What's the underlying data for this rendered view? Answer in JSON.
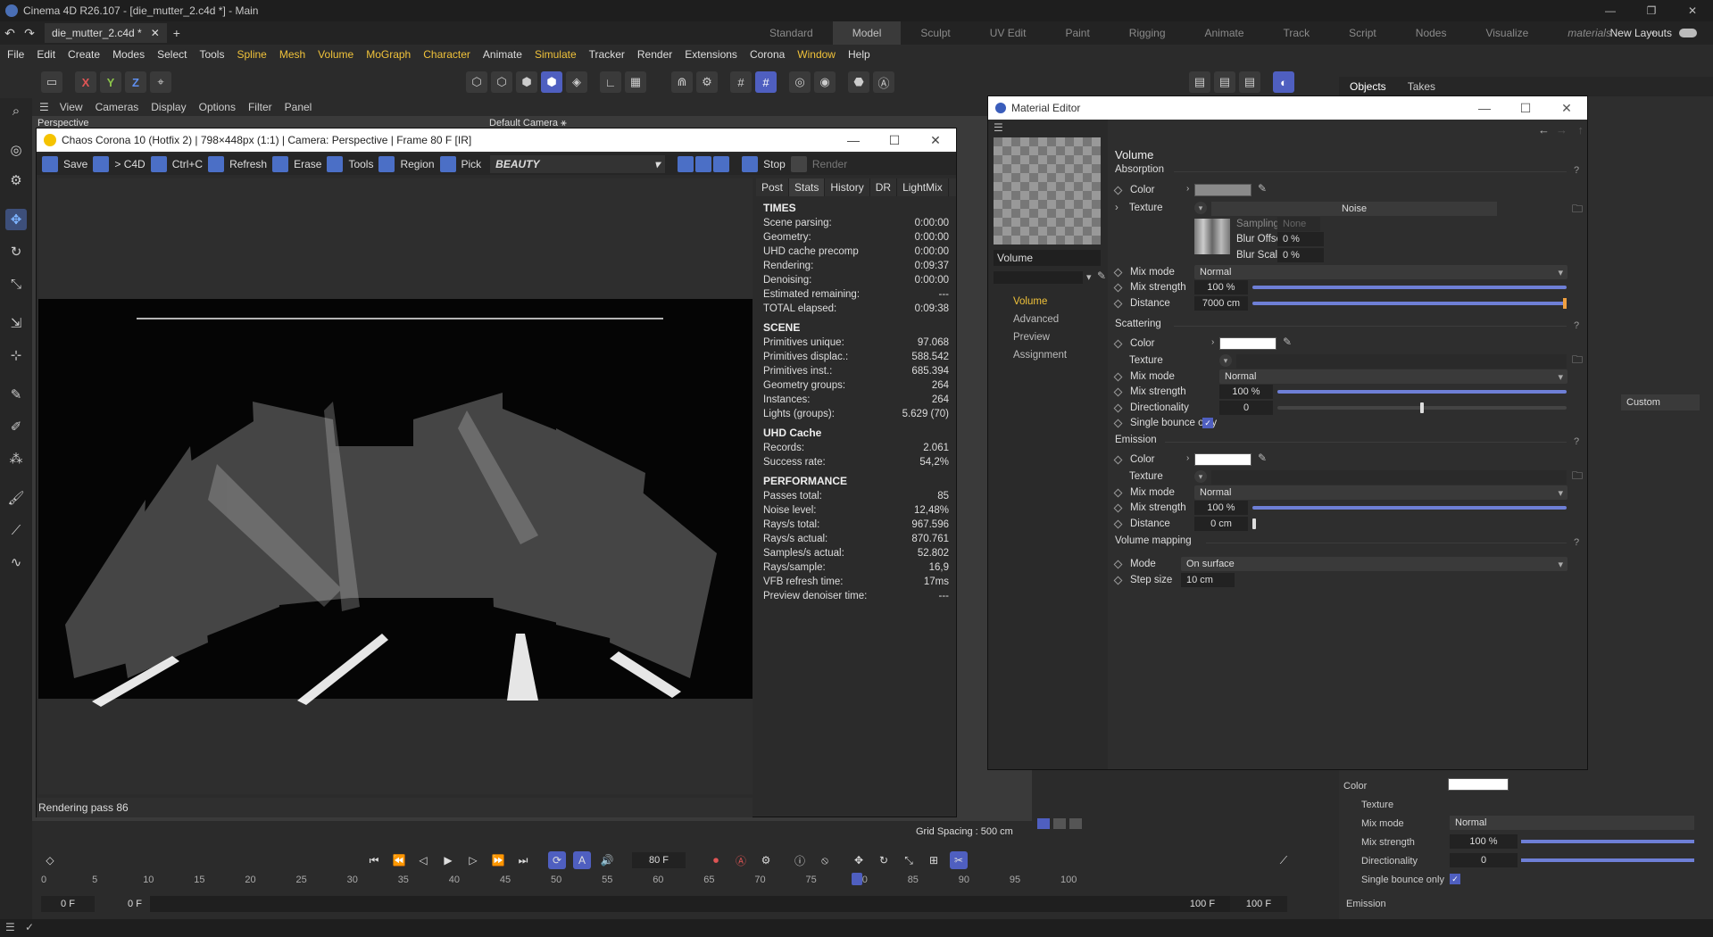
{
  "window": {
    "title": "Cinema 4D R26.107 - [die_mutter_2.c4d *] - Main",
    "min": "—",
    "max": "❐",
    "close": "✕"
  },
  "doc_tab": {
    "label": "die_mutter_2.c4d *",
    "close": "✕",
    "add": "+"
  },
  "layouts": [
    "Standard",
    "Model",
    "Sculpt",
    "UV Edit",
    "Paint",
    "Rigging",
    "Animate",
    "Track",
    "Script",
    "Nodes",
    "Visualize",
    "materials"
  ],
  "new_layouts": "New Layouts",
  "menu": [
    "File",
    "Edit",
    "Create",
    "Modes",
    "Select",
    "Tools",
    "Spline",
    "Mesh",
    "Volume",
    "MoGraph",
    "Character",
    "Animate",
    "Simulate",
    "Tracker",
    "Render",
    "Extensions",
    "Corona",
    "Window",
    "Help"
  ],
  "axes": {
    "x": "X",
    "y": "Y",
    "z": "Z"
  },
  "view_menu": [
    "View",
    "Cameras",
    "Display",
    "Options",
    "Filter",
    "Panel"
  ],
  "viewport": {
    "label": "Perspective",
    "camera": "Default Camera ⚹",
    "grid_spacing": "Grid Spacing : 500 cm"
  },
  "right_panel": {
    "tabs": [
      "Objects",
      "Takes"
    ],
    "custom": "Custom",
    "color_label": "Color",
    "texture_label": "Texture",
    "mixmode_label": "Mix mode",
    "mixmode_value": "Normal",
    "mixstrength_label": "Mix strength",
    "mixstrength_value": "100 %",
    "directionality_label": "Directionality",
    "directionality_value": "0",
    "single_bounce_label": "Single bounce only",
    "emission_label": "Emission",
    "qm": "?"
  },
  "corona": {
    "title": "Chaos Corona 10 (Hotfix 2) | 798×448px (1:1) | Camera: Perspective | Frame 80 F [IR]",
    "buttons": {
      "save": "Save",
      "c4d": "> C4D",
      "ctrlc": "Ctrl+C",
      "refresh": "Refresh",
      "erase": "Erase",
      "tools": "Tools",
      "region": "Region",
      "pick": "Pick",
      "stop": "Stop",
      "render": "Render"
    },
    "beauty": "BEAUTY",
    "stat_tabs": [
      "Post",
      "Stats",
      "History",
      "DR",
      "LightMix"
    ],
    "sections": {
      "times": {
        "title": "TIMES",
        "rows": [
          [
            "Scene parsing:",
            "0:00:00"
          ],
          [
            "Geometry:",
            "0:00:00"
          ],
          [
            "UHD cache precomp",
            "0:00:00"
          ],
          [
            "Rendering:",
            "0:09:37"
          ],
          [
            "Denoising:",
            "0:00:00"
          ],
          [
            "Estimated remaining:",
            "---"
          ],
          [
            "TOTAL elapsed:",
            "0:09:38"
          ]
        ]
      },
      "scene": {
        "title": "SCENE",
        "rows": [
          [
            "Primitives unique:",
            "97.068"
          ],
          [
            "Primitives displac.:",
            "588.542"
          ],
          [
            "Primitives inst.:",
            "685.394"
          ],
          [
            "Geometry groups:",
            "264"
          ],
          [
            "Instances:",
            "264"
          ],
          [
            "Lights (groups):",
            "5.629 (70)"
          ]
        ]
      },
      "uhd": {
        "title": "UHD Cache",
        "rows": [
          [
            "Records:",
            "2.061"
          ],
          [
            "Success rate:",
            "54,2%"
          ]
        ]
      },
      "perf": {
        "title": "PERFORMANCE",
        "rows": [
          [
            "Passes total:",
            "85"
          ],
          [
            "Noise level:",
            "12,48%"
          ],
          [
            "Rays/s total:",
            "967.596"
          ],
          [
            "Rays/s actual:",
            "870.761"
          ],
          [
            "Samples/s actual:",
            "52.802"
          ],
          [
            "Rays/sample:",
            "16,9"
          ],
          [
            "VFB refresh time:",
            "17ms"
          ],
          [
            "Preview denoiser time:",
            "---"
          ]
        ]
      }
    },
    "status": "Rendering pass 86"
  },
  "material_editor": {
    "title": "Material Editor",
    "name": "Volume",
    "nav": [
      "Volume",
      "Advanced",
      "Preview",
      "Assignment"
    ],
    "header": "Volume",
    "absorption": {
      "title": "Absorption",
      "color": "Color",
      "texture": "Texture",
      "noise": "Noise",
      "sampling": "Sampling",
      "sampling_value": "None",
      "blur_offset": "Blur Offset",
      "blur_offset_value": "0 %",
      "blur_scale": "Blur Scale",
      "blur_scale_value": "0 %",
      "mixmode": "Mix mode",
      "mixmode_value": "Normal",
      "mixstrength": "Mix strength",
      "mixstrength_value": "100 %",
      "distance": "Distance",
      "distance_value": "7000 cm",
      "swatch": "#8a8a8a"
    },
    "scattering": {
      "title": "Scattering",
      "color": "Color",
      "texture": "Texture",
      "mixmode": "Mix mode",
      "mixmode_value": "Normal",
      "mixstrength": "Mix strength",
      "mixstrength_value": "100 %",
      "directionality": "Directionality",
      "directionality_value": "0",
      "single_bounce": "Single bounce only",
      "swatch": "#ffffff"
    },
    "emission": {
      "title": "Emission",
      "color": "Color",
      "texture": "Texture",
      "mixmode": "Mix mode",
      "mixmode_value": "Normal",
      "mixstrength": "Mix strength",
      "mixstrength_value": "100 %",
      "distance": "Distance",
      "distance_value": "0 cm",
      "swatch": "#ffffff"
    },
    "mapping": {
      "title": "Volume mapping",
      "mode": "Mode",
      "mode_value": "On surface",
      "step": "Step size",
      "step_value": "10 cm"
    },
    "qm": "?"
  },
  "timeline": {
    "current_frame": "80 F",
    "start": "0 F",
    "start2": "0 F",
    "end": "100 F",
    "end2": "100 F",
    "ticks": [
      "0",
      "5",
      "10",
      "15",
      "20",
      "25",
      "30",
      "35",
      "40",
      "45",
      "50",
      "55",
      "60",
      "65",
      "70",
      "75",
      "80",
      "85",
      "90",
      "95",
      "100"
    ]
  },
  "colors": {
    "accent": "#4f5fc0",
    "highlight": "#f0c23a"
  }
}
